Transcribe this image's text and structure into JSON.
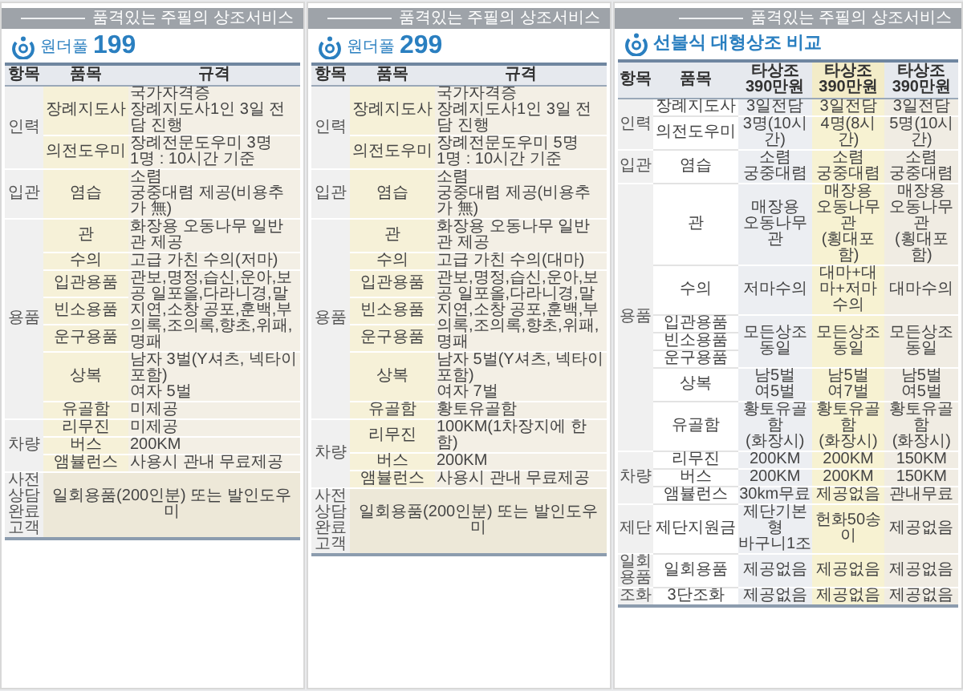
{
  "pages": [
    {
      "kind": "package",
      "banner": "품격있는 주필의 상조서비스",
      "title": {
        "label": "원더풀",
        "number": "199"
      },
      "table": {
        "columns": [
          "항목",
          "품목",
          "규격"
        ],
        "groups": [
          {
            "category": "인력",
            "rows": [
              {
                "items": [
                  "장례지도사"
                ],
                "spec": "국가자격증\n장례지도사1인 3일 전담 진행"
              },
              {
                "items": [
                  "의전도우미"
                ],
                "spec": "장례전문도우미 3명\n1명 : 10시간 기준"
              }
            ]
          },
          {
            "category": "입관",
            "rows": [
              {
                "items": [
                  "염습"
                ],
                "spec": "소렴\n궁중대렴 제공(비용추가 無)"
              }
            ]
          },
          {
            "category": "용품",
            "rows": [
              {
                "items": [
                  "관"
                ],
                "spec": "화장용 오동나무 일반관 제공"
              },
              {
                "items": [
                  "수의"
                ],
                "spec": "고급 가친 수의(저마)"
              },
              {
                "items": [
                  "입관용품",
                  "빈소용품",
                  "운구용품"
                ],
                "spec": "관보,명정,습신,운아,보공 일포올,다라니경,말지연,소창 공포,훈백,부의록,조의록,향초,위패,명패"
              },
              {
                "items": [
                  "상복"
                ],
                "spec": "남자 3벌(Y셔츠, 넥타이 포함)\n여자 5벌"
              },
              {
                "items": [
                  "유골함"
                ],
                "spec": "미제공"
              }
            ]
          },
          {
            "category": "차량",
            "rows": [
              {
                "items": [
                  "리무진"
                ],
                "spec": "미제공"
              },
              {
                "items": [
                  "버스"
                ],
                "spec": "200KM"
              },
              {
                "items": [
                  "앰뷸런스"
                ],
                "spec": "사용시 관내 무료제공"
              }
            ]
          }
        ],
        "footer": {
          "category": "사전상담\n완료고객",
          "spec": "일회용품(200인분) 또는 발인도우미"
        }
      }
    },
    {
      "kind": "package",
      "banner": "품격있는 주필의 상조서비스",
      "title": {
        "label": "원더풀",
        "number": "299"
      },
      "table": {
        "columns": [
          "항목",
          "품목",
          "규격"
        ],
        "groups": [
          {
            "category": "인력",
            "rows": [
              {
                "items": [
                  "장례지도사"
                ],
                "spec": "국가자격증\n장례지도사1인 3일 전담 진행"
              },
              {
                "items": [
                  "의전도우미"
                ],
                "spec": "장례전문도우미 5명\n1명 : 10시간 기준"
              }
            ]
          },
          {
            "category": "입관",
            "rows": [
              {
                "items": [
                  "염습"
                ],
                "spec": "소렴\n궁중대렴 제공(비용추가 無)"
              }
            ]
          },
          {
            "category": "용품",
            "rows": [
              {
                "items": [
                  "관"
                ],
                "spec": "화장용 오동나무 일반관 제공"
              },
              {
                "items": [
                  "수의"
                ],
                "spec": "고급 가친 수의(대마)"
              },
              {
                "items": [
                  "입관용품",
                  "빈소용품",
                  "운구용품"
                ],
                "spec": "관보,명정,습신,운아,보공 일포올,다라니경,말지연,소창 공포,훈백,부의록,조의록,향초,위패,명패"
              },
              {
                "items": [
                  "상복"
                ],
                "spec": "남자 5벌(Y셔츠, 넥타이 포함)\n여자 7벌"
              },
              {
                "items": [
                  "유골함"
                ],
                "spec": "황토유골함"
              }
            ]
          },
          {
            "category": "차량",
            "rows": [
              {
                "items": [
                  "리무진"
                ],
                "spec": "100KM(1차장지에 한함)"
              },
              {
                "items": [
                  "버스"
                ],
                "spec": "200KM"
              },
              {
                "items": [
                  "앰뷸런스"
                ],
                "spec": "사용시 관내 무료제공"
              }
            ]
          }
        ],
        "footer": {
          "category": "사전상담\n완료고객",
          "spec": "일회용품(200인분) 또는 발인도우미"
        }
      }
    },
    {
      "kind": "comparison",
      "banner": "품격있는 주필의 상조서비스",
      "title": {
        "label": "선불식 대형상조 비교"
      },
      "table": {
        "columns": [
          "항목",
          "품목",
          "타상조\n390만원",
          "타상조\n390만원",
          "타상조\n390만원"
        ],
        "groups": [
          {
            "category": "인력",
            "rows": [
              {
                "items": [
                  "장례지도사"
                ],
                "values": [
                  "3일전담",
                  "3일전담",
                  "3일전담"
                ]
              },
              {
                "items": [
                  "의전도우미"
                ],
                "values": [
                  "3명(10시간)",
                  "4명(8시간)",
                  "5명(10시간)"
                ]
              }
            ]
          },
          {
            "category": "입관",
            "rows": [
              {
                "items": [
                  "염습"
                ],
                "values": [
                  "소렴\n궁중대렴",
                  "소렴\n궁중대렴",
                  "소렴\n궁중대렴"
                ]
              }
            ]
          },
          {
            "category": "용품",
            "rows": [
              {
                "items": [
                  "관"
                ],
                "values": [
                  "매장용\n오동나무관",
                  "매장용\n오동나무관\n(횡대포함)",
                  "매장용\n오동나무관\n(횡대포함)"
                ]
              },
              {
                "items": [
                  "수의"
                ],
                "values": [
                  "저마수의",
                  "대마+대마+저마\n수의",
                  "대마수의"
                ]
              },
              {
                "items": [
                  "입관용품",
                  "빈소용품",
                  "운구용품"
                ],
                "values": [
                  "모든상조\n동일",
                  "모든상조\n동일",
                  "모든상조\n동일"
                ]
              },
              {
                "items": [
                  "상복"
                ],
                "values": [
                  "남5벌\n여5벌",
                  "남5벌\n여7벌",
                  "남5벌\n여5벌"
                ]
              },
              {
                "items": [
                  "유골함"
                ],
                "values": [
                  "황토유골함\n(화장시)",
                  "황토유골함\n(화장시)",
                  "황토유골함\n(화장시)"
                ]
              }
            ]
          },
          {
            "category": "차량",
            "rows": [
              {
                "items": [
                  "리무진"
                ],
                "values": [
                  "200KM",
                  "200KM",
                  "150KM"
                ]
              },
              {
                "items": [
                  "버스"
                ],
                "values": [
                  "200KM",
                  "200KM",
                  "150KM"
                ]
              },
              {
                "items": [
                  "앰뷸런스"
                ],
                "values": [
                  "30km무료",
                  "제공없음",
                  "관내무료"
                ]
              }
            ]
          },
          {
            "category": "제단",
            "rows": [
              {
                "items": [
                  "제단지원금"
                ],
                "values": [
                  "제단기본형\n바구니1조",
                  "헌화50송이",
                  "제공없음"
                ]
              }
            ]
          },
          {
            "category": "일회용품",
            "rows": [
              {
                "items": [
                  "일회용품"
                ],
                "values": [
                  "제공없음",
                  "제공없음",
                  "제공없음"
                ]
              }
            ]
          },
          {
            "category": "조화",
            "rows": [
              {
                "items": [
                  "3단조화"
                ],
                "values": [
                  "제공없음",
                  "제공없음",
                  "제공없음"
                ]
              }
            ]
          }
        ]
      }
    }
  ]
}
